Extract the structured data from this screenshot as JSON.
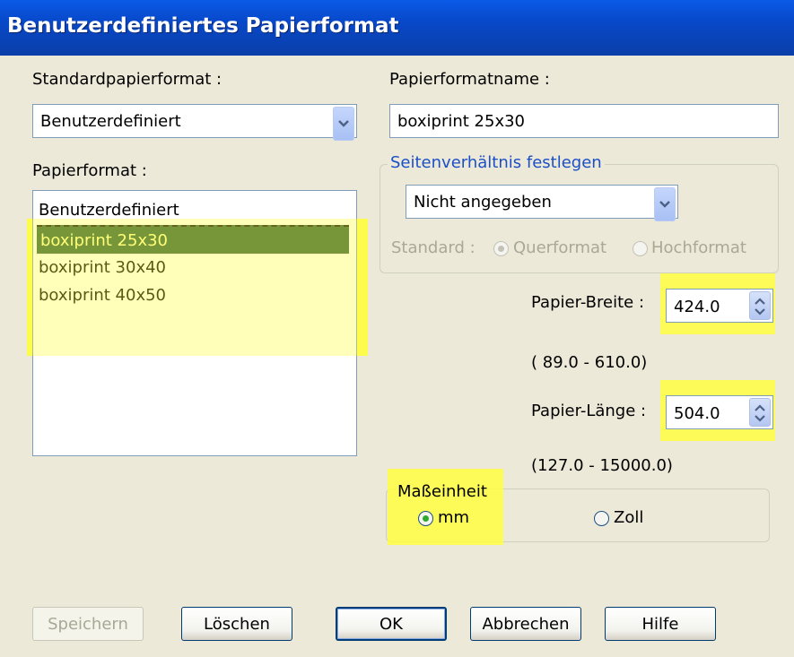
{
  "window": {
    "title": "Benutzerdefiniertes Papierformat"
  },
  "standard_paper": {
    "label": "Standardpapierformat :",
    "value": "Benutzerdefiniert"
  },
  "paper_name": {
    "label": "Papierformatname :",
    "value": "boxiprint 25x30"
  },
  "paper_format": {
    "label": "Papierformat :",
    "items": [
      "Benutzerdefiniert",
      "boxiprint 25x30",
      "boxiprint 30x40",
      "boxiprint 40x50"
    ],
    "selected_index": 1
  },
  "aspect": {
    "legend": "Seitenverhältnis festlegen",
    "value": "Nicht angegeben",
    "standard_label": "Standard :",
    "landscape": "Querformat",
    "portrait": "Hochformat"
  },
  "width": {
    "label": "Papier-Breite :",
    "value": "424.0",
    "range": "( 89.0 - 610.0)"
  },
  "length": {
    "label": "Papier-Länge :",
    "value": "504.0",
    "range": "(127.0 - 15000.0)"
  },
  "unit": {
    "legend": "Maßeinheit",
    "mm": "mm",
    "inch": "Zoll",
    "selected": "mm"
  },
  "buttons": {
    "save": "Speichern",
    "delete": "Löschen",
    "ok": "OK",
    "cancel": "Abbrechen",
    "help": "Hilfe"
  },
  "colors": {
    "titlebar": "#0a5ae8",
    "highlight": "#ffff3a",
    "selected_item": "#2f5f3a"
  },
  "icons": {
    "combo_arrow": "chevron-down-icon",
    "spin": "spin-arrows-icon"
  }
}
